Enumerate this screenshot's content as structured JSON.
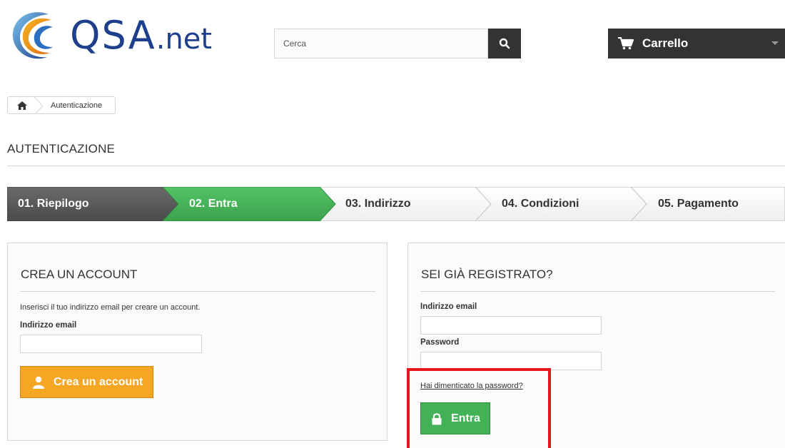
{
  "header": {
    "logo": {
      "text": "QSA",
      "suffix": ".net"
    },
    "search": {
      "placeholder": "Cerca",
      "icon": "search-icon"
    },
    "cart": {
      "label": "Carrello",
      "icon": "cart-icon",
      "caret_icon": "chevron-down-icon"
    }
  },
  "breadcrumb": {
    "home_icon": "home-icon",
    "current": "Autenticazione"
  },
  "page": {
    "title": "AUTENTICAZIONE"
  },
  "steps": [
    {
      "label": "01. Riepilogo",
      "state": "done"
    },
    {
      "label": "02. Entra",
      "state": "current"
    },
    {
      "label": "03. Indirizzo",
      "state": "todo"
    },
    {
      "label": "04. Condizioni",
      "state": "todo"
    },
    {
      "label": "05. Pagamento",
      "state": "todo"
    }
  ],
  "create_account": {
    "title": "CREA UN ACCOUNT",
    "description": "Inserisci il tuo indirizzo email per creare un account.",
    "email_label": "Indirizzo email",
    "email_value": "",
    "button_label": "Crea un account",
    "button_icon": "user-icon"
  },
  "login": {
    "title": "SEI GIÀ REGISTRATO?",
    "email_label": "Indirizzo email",
    "email_value": "",
    "password_label": "Password",
    "password_value": "",
    "forgot_label": "Hai dimenticato la password?",
    "button_label": "Entra",
    "button_icon": "lock-icon"
  },
  "colors": {
    "dark": "#333333",
    "step_done": "#5a5a5a",
    "step_current": "#43b155",
    "create_button": "#f5a623",
    "login_button": "#43b155",
    "highlight": "#e8141b"
  }
}
